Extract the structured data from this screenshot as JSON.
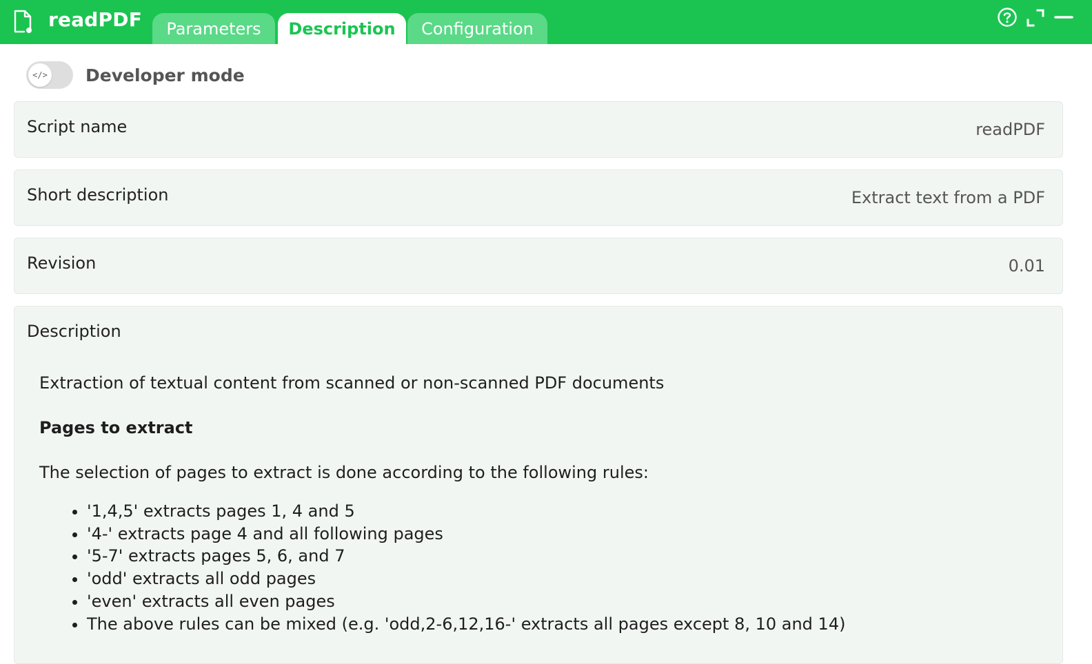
{
  "app": {
    "title": "readPDF"
  },
  "tabs": [
    {
      "label": "Parameters",
      "active": false
    },
    {
      "label": "Description",
      "active": true
    },
    {
      "label": "Configuration",
      "active": false
    }
  ],
  "header_icons": [
    "help-icon",
    "expand-icon",
    "minimize-icon"
  ],
  "developer_mode": {
    "label": "Developer mode",
    "toggle_glyph": "</>",
    "enabled": false
  },
  "fields": {
    "script_name": {
      "label": "Script name",
      "value": "readPDF"
    },
    "short_description": {
      "label": "Short description",
      "value": "Extract text from a PDF"
    },
    "revision": {
      "label": "Revision",
      "value": "0.01"
    }
  },
  "description": {
    "label": "Description",
    "intro": "Extraction of textual content from scanned or non-scanned PDF documents",
    "heading": "Pages to extract",
    "rules_intro": "The selection of pages to extract is done according to the following rules:",
    "rules": [
      "'1,4,5' extracts pages 1, 4 and 5",
      "'4-' extracts page 4 and all following pages",
      "'5-7' extracts pages 5, 6, and 7",
      "'odd' extracts all odd pages",
      "'even' extracts all even pages",
      "The above rules can be mixed (e.g. 'odd,2-6,12,16-' extracts all pages except 8, 10 and 14)"
    ]
  },
  "colors": {
    "brand_green": "#1bc451",
    "tab_inactive": "#5ad987",
    "card_background": "#f2f6f3"
  }
}
